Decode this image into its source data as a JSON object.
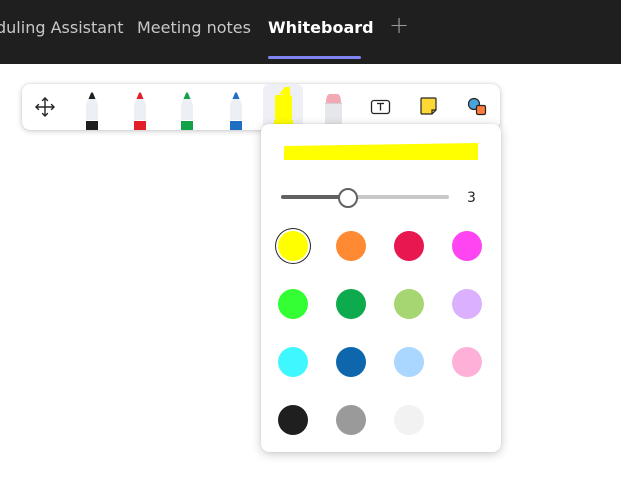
{
  "tabs": [
    {
      "label": "duling Assistant",
      "active": false
    },
    {
      "label": "Meeting notes",
      "active": false
    },
    {
      "label": "Whiteboard",
      "active": true
    }
  ],
  "add_tab_icon": "plus-icon",
  "toolbar": {
    "tools": [
      {
        "name": "move-icon"
      },
      {
        "name": "black-pen",
        "color": "#1f1f1f"
      },
      {
        "name": "red-pen",
        "color": "#e3202a"
      },
      {
        "name": "green-pen",
        "color": "#13a24a"
      },
      {
        "name": "blue-pen",
        "color": "#1e6fc3"
      },
      {
        "name": "yellow-highlighter",
        "color": "#ffff00",
        "selected": true
      },
      {
        "name": "eraser",
        "color": "#f4a8b4"
      },
      {
        "name": "text-icon"
      },
      {
        "name": "sticky-note-icon",
        "color": "#fdd835"
      },
      {
        "name": "shapes-icon"
      }
    ]
  },
  "popup": {
    "preview_color": "#ffff00",
    "width_value": "3",
    "width_fraction": 0.4,
    "colors": [
      {
        "hex": "#ffff00",
        "selected": true
      },
      {
        "hex": "#ff8a33"
      },
      {
        "hex": "#e8174f"
      },
      {
        "hex": "#ff44f2"
      },
      {
        "hex": "#33ff33"
      },
      {
        "hex": "#0daa4e"
      },
      {
        "hex": "#a5d672"
      },
      {
        "hex": "#dbb0ff"
      },
      {
        "hex": "#3ff7ff"
      },
      {
        "hex": "#0e67ad"
      },
      {
        "hex": "#a9d7ff"
      },
      {
        "hex": "#ffb0d8"
      },
      {
        "hex": "#1f1f1f"
      },
      {
        "hex": "#9a9a9a"
      },
      {
        "hex": "#f2f2f2"
      }
    ]
  }
}
